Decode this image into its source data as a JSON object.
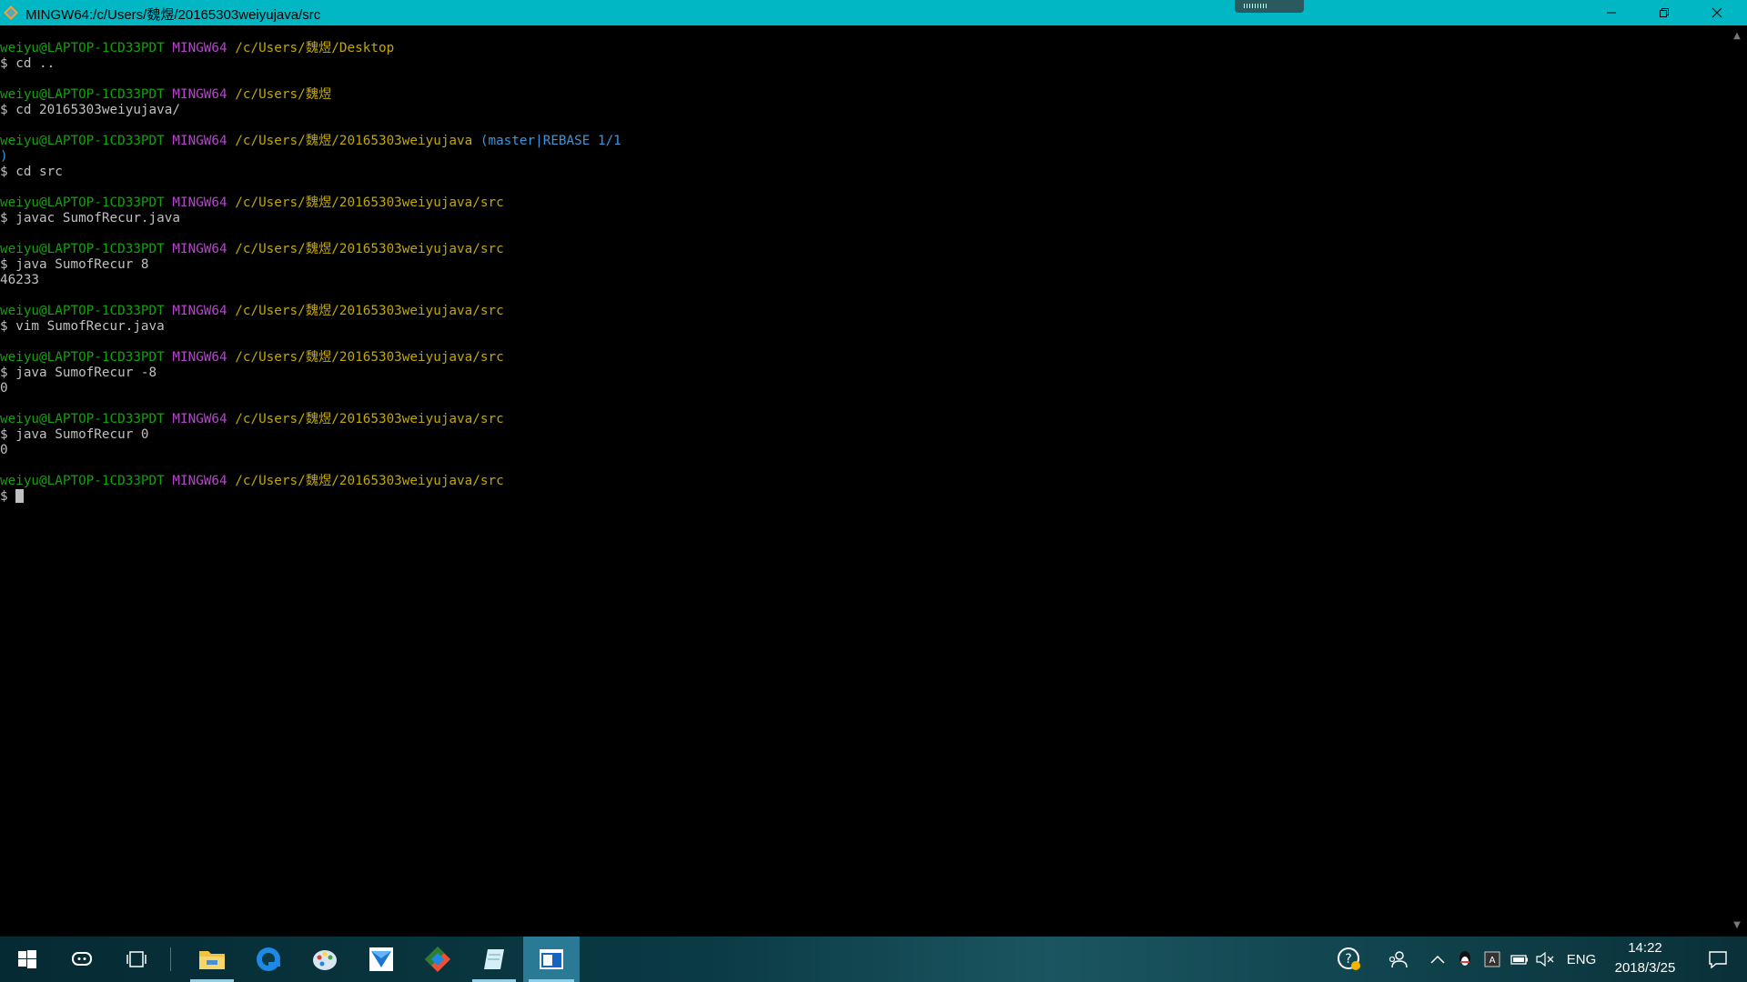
{
  "window": {
    "title": "MINGW64:/c/Users/魏煜/20165303weiyujava/src"
  },
  "terminal": {
    "colors": {
      "user": "#13a10e",
      "mingw": "#b148c6",
      "path": "#c1a800",
      "git": "#3a96dd",
      "text": "#c0c0c0"
    },
    "lines": [
      {
        "type": "prompt",
        "user": "weiyu@LAPTOP-1CD33PDT",
        "shell": "MINGW64",
        "path": "/c/Users/魏煜/Desktop",
        "git": ""
      },
      {
        "type": "text",
        "text": "$ cd .."
      },
      {
        "type": "blank"
      },
      {
        "type": "prompt",
        "user": "weiyu@LAPTOP-1CD33PDT",
        "shell": "MINGW64",
        "path": "/c/Users/魏煜",
        "git": ""
      },
      {
        "type": "text",
        "text": "$ cd 20165303weiyujava/"
      },
      {
        "type": "blank"
      },
      {
        "type": "prompt",
        "user": "weiyu@LAPTOP-1CD33PDT",
        "shell": "MINGW64",
        "path": "/c/Users/魏煜/20165303weiyujava",
        "git": "(master|REBASE 1/1"
      },
      {
        "type": "gitwrap",
        "text": ")"
      },
      {
        "type": "text",
        "text": "$ cd src"
      },
      {
        "type": "blank"
      },
      {
        "type": "prompt",
        "user": "weiyu@LAPTOP-1CD33PDT",
        "shell": "MINGW64",
        "path": "/c/Users/魏煜/20165303weiyujava/src",
        "git": ""
      },
      {
        "type": "text",
        "text": "$ javac SumofRecur.java"
      },
      {
        "type": "blank"
      },
      {
        "type": "prompt",
        "user": "weiyu@LAPTOP-1CD33PDT",
        "shell": "MINGW64",
        "path": "/c/Users/魏煜/20165303weiyujava/src",
        "git": ""
      },
      {
        "type": "text",
        "text": "$ java SumofRecur 8"
      },
      {
        "type": "text",
        "text": "46233"
      },
      {
        "type": "blank"
      },
      {
        "type": "prompt",
        "user": "weiyu@LAPTOP-1CD33PDT",
        "shell": "MINGW64",
        "path": "/c/Users/魏煜/20165303weiyujava/src",
        "git": ""
      },
      {
        "type": "text",
        "text": "$ vim SumofRecur.java"
      },
      {
        "type": "blank"
      },
      {
        "type": "prompt",
        "user": "weiyu@LAPTOP-1CD33PDT",
        "shell": "MINGW64",
        "path": "/c/Users/魏煜/20165303weiyujava/src",
        "git": ""
      },
      {
        "type": "text",
        "text": "$ java SumofRecur -8"
      },
      {
        "type": "text",
        "text": "0"
      },
      {
        "type": "blank"
      },
      {
        "type": "prompt",
        "user": "weiyu@LAPTOP-1CD33PDT",
        "shell": "MINGW64",
        "path": "/c/Users/魏煜/20165303weiyujava/src",
        "git": ""
      },
      {
        "type": "text",
        "text": "$ java SumofRecur 0"
      },
      {
        "type": "text",
        "text": "0"
      },
      {
        "type": "blank"
      },
      {
        "type": "prompt",
        "user": "weiyu@LAPTOP-1CD33PDT",
        "shell": "MINGW64",
        "path": "/c/Users/魏煜/20165303weiyujava/src",
        "git": ""
      },
      {
        "type": "cursorline",
        "text": "$ "
      }
    ]
  },
  "taskbar": {
    "apps": [
      "start-icon",
      "cortana-icon",
      "task-view-icon",
      "file-explorer-icon",
      "browser-icon",
      "paint-icon",
      "mail-icon",
      "git-icon",
      "notepad-icon",
      "terminal-icon"
    ],
    "tray": {
      "language": "ENG",
      "time": "14:22",
      "date": "2018/3/25"
    }
  }
}
